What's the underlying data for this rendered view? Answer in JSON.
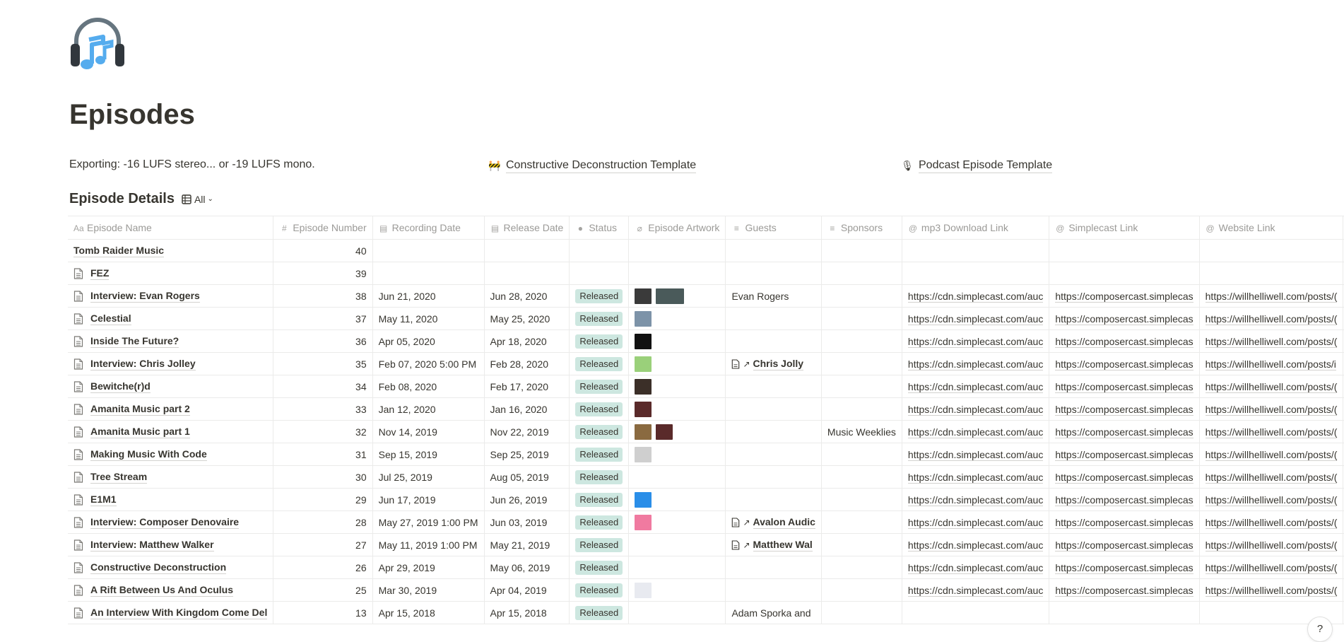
{
  "page": {
    "icon": "headphones-music-icon",
    "title": "Episodes"
  },
  "callouts": {
    "exporting_label": "Exporting:",
    "exporting_text": " -16 LUFS stereo... or -19 LUFS mono.",
    "links": [
      {
        "icon": "construction-barrier-icon",
        "label": "Constructive Deconstruction Template"
      },
      {
        "icon": "microphone-icon",
        "label": "Podcast Episode Template"
      }
    ]
  },
  "database": {
    "title": "Episode Details",
    "view_icon": "table-icon",
    "view_label": "All",
    "columns": [
      {
        "icon": "text-icon",
        "label": "Episode Name"
      },
      {
        "icon": "number-icon",
        "label": "Episode Number"
      },
      {
        "icon": "calendar-icon",
        "label": "Recording Date"
      },
      {
        "icon": "calendar-icon",
        "label": "Release Date"
      },
      {
        "icon": "select-icon",
        "label": "Status"
      },
      {
        "icon": "paperclip-icon",
        "label": "Episode Artwork"
      },
      {
        "icon": "text-lines-icon",
        "label": "Guests"
      },
      {
        "icon": "text-lines-icon",
        "label": "Sponsors"
      },
      {
        "icon": "url-icon",
        "label": "mp3 Download Link"
      },
      {
        "icon": "url-icon",
        "label": "Simplecast Link"
      },
      {
        "icon": "url-icon",
        "label": "Website Link"
      }
    ],
    "add_column_label": "+",
    "status_color": "#cde7e0",
    "rows": [
      {
        "name": "Tomb Raider Music",
        "has_doc_icon": false,
        "number": "40",
        "recording": "",
        "release": "",
        "status": "",
        "artwork": [],
        "guests": "",
        "guest_relation": false,
        "sponsors": "",
        "mp3": "",
        "simplecast": "",
        "website": ""
      },
      {
        "name": "FEZ",
        "has_doc_icon": true,
        "number": "39",
        "recording": "",
        "release": "",
        "status": "",
        "artwork": [],
        "guests": "",
        "guest_relation": false,
        "sponsors": "",
        "mp3": "",
        "simplecast": "",
        "website": ""
      },
      {
        "name": "Interview: Evan Rogers",
        "has_doc_icon": true,
        "number": "38",
        "recording": "Jun 21, 2020",
        "release": "Jun 28, 2020",
        "status": "Released",
        "artwork": [
          "#3a3a3a",
          "#4a5a5a"
        ],
        "guests": "Evan Rogers",
        "guest_relation": false,
        "sponsors": "",
        "mp3": "https://cdn.simplecast.com/auc",
        "simplecast": "https://composercast.simplecas",
        "website": "https://willhelliwell.com/posts/("
      },
      {
        "name": "Celestial",
        "has_doc_icon": true,
        "number": "37",
        "recording": "May 11, 2020",
        "release": "May 25, 2020",
        "status": "Released",
        "artwork": [
          "#7d93a8"
        ],
        "guests": "",
        "guest_relation": false,
        "sponsors": "",
        "mp3": "https://cdn.simplecast.com/auc",
        "simplecast": "https://composercast.simplecas",
        "website": "https://willhelliwell.com/posts/("
      },
      {
        "name": "Inside The Future?",
        "has_doc_icon": true,
        "number": "36",
        "recording": "Apr 05, 2020",
        "release": "Apr 18, 2020",
        "status": "Released",
        "artwork": [
          "#111111"
        ],
        "guests": "",
        "guest_relation": false,
        "sponsors": "",
        "mp3": "https://cdn.simplecast.com/auc",
        "simplecast": "https://composercast.simplecas",
        "website": "https://willhelliwell.com/posts/("
      },
      {
        "name": "Interview: Chris Jolley",
        "has_doc_icon": true,
        "number": "35",
        "recording": "Feb 07, 2020 5:00 PM",
        "release": "Feb 28, 2020",
        "status": "Released",
        "artwork": [
          "#9ad07a"
        ],
        "guests": "Chris Jolly",
        "guest_relation": true,
        "sponsors": "",
        "mp3": "https://cdn.simplecast.com/auc",
        "simplecast": "https://composercast.simplecas",
        "website": "https://willhelliwell.com/posts/i"
      },
      {
        "name": "Bewitche(r)d",
        "has_doc_icon": true,
        "number": "34",
        "recording": "Feb 08, 2020",
        "release": "Feb 17, 2020",
        "status": "Released",
        "artwork": [
          "#3b2f28"
        ],
        "guests": "",
        "guest_relation": false,
        "sponsors": "",
        "mp3": "https://cdn.simplecast.com/auc",
        "simplecast": "https://composercast.simplecas",
        "website": "https://willhelliwell.com/posts/("
      },
      {
        "name": "Amanita Music part 2",
        "has_doc_icon": true,
        "number": "33",
        "recording": "Jan 12, 2020",
        "release": "Jan 16, 2020",
        "status": "Released",
        "artwork": [
          "#5a2a2a"
        ],
        "guests": "",
        "guest_relation": false,
        "sponsors": "",
        "mp3": "https://cdn.simplecast.com/auc",
        "simplecast": "https://composercast.simplecas",
        "website": "https://willhelliwell.com/posts/("
      },
      {
        "name": "Amanita Music part 1",
        "has_doc_icon": true,
        "number": "32",
        "recording": "Nov 14, 2019",
        "release": "Nov 22, 2019",
        "status": "Released",
        "artwork": [
          "#8a6a40",
          "#5a2a2a"
        ],
        "guests": "",
        "guest_relation": false,
        "sponsors": "Music Weeklies",
        "mp3": "https://cdn.simplecast.com/auc",
        "simplecast": "https://composercast.simplecas",
        "website": "https://willhelliwell.com/posts/("
      },
      {
        "name": "Making Music With Code",
        "has_doc_icon": true,
        "number": "31",
        "recording": "Sep 15, 2019",
        "release": "Sep 25, 2019",
        "status": "Released",
        "artwork": [
          "#cfcfcf"
        ],
        "guests": "",
        "guest_relation": false,
        "sponsors": "",
        "mp3": "https://cdn.simplecast.com/auc",
        "simplecast": "https://composercast.simplecas",
        "website": "https://willhelliwell.com/posts/("
      },
      {
        "name": "Tree Stream",
        "has_doc_icon": true,
        "number": "30",
        "recording": "Jul 25, 2019",
        "release": "Aug 05, 2019",
        "status": "Released",
        "artwork": [],
        "guests": "",
        "guest_relation": false,
        "sponsors": "",
        "mp3": "https://cdn.simplecast.com/auc",
        "simplecast": "https://composercast.simplecas",
        "website": "https://willhelliwell.com/posts/("
      },
      {
        "name": "E1M1",
        "has_doc_icon": true,
        "number": "29",
        "recording": "Jun 17, 2019",
        "release": "Jun 26, 2019",
        "status": "Released",
        "artwork": [
          "#2a8ee8"
        ],
        "guests": "",
        "guest_relation": false,
        "sponsors": "",
        "mp3": "https://cdn.simplecast.com/auc",
        "simplecast": "https://composercast.simplecas",
        "website": "https://willhelliwell.com/posts/("
      },
      {
        "name": "Interview: Composer Denovaire",
        "has_doc_icon": true,
        "number": "28",
        "recording": "May 27, 2019 1:00 PM",
        "release": "Jun 03, 2019",
        "status": "Released",
        "artwork": [
          "#f07aa0"
        ],
        "guests": "Avalon Audic",
        "guest_relation": true,
        "sponsors": "",
        "mp3": "https://cdn.simplecast.com/auc",
        "simplecast": "https://composercast.simplecas",
        "website": "https://willhelliwell.com/posts/("
      },
      {
        "name": "Interview: Matthew Walker",
        "has_doc_icon": true,
        "number": "27",
        "recording": "May 11, 2019 1:00 PM",
        "release": "May 21, 2019",
        "status": "Released",
        "artwork": [],
        "guests": "Matthew Wal",
        "guest_relation": true,
        "sponsors": "",
        "mp3": "https://cdn.simplecast.com/auc",
        "simplecast": "https://composercast.simplecas",
        "website": "https://willhelliwell.com/posts/("
      },
      {
        "name": "Constructive Deconstruction",
        "has_doc_icon": true,
        "number": "26",
        "recording": "Apr 29, 2019",
        "release": "May 06, 2019",
        "status": "Released",
        "artwork": [],
        "guests": "",
        "guest_relation": false,
        "sponsors": "",
        "mp3": "https://cdn.simplecast.com/auc",
        "simplecast": "https://composercast.simplecas",
        "website": "https://willhelliwell.com/posts/("
      },
      {
        "name": "A Rift Between Us And Oculus",
        "has_doc_icon": true,
        "number": "25",
        "recording": "Mar 30, 2019",
        "release": "Apr 04, 2019",
        "status": "Released",
        "artwork": [
          "#e8eaf0"
        ],
        "guests": "",
        "guest_relation": false,
        "sponsors": "",
        "mp3": "https://cdn.simplecast.com/auc",
        "simplecast": "https://composercast.simplecas",
        "website": "https://willhelliwell.com/posts/("
      },
      {
        "name": "An Interview With Kingdom Come Del",
        "has_doc_icon": true,
        "number": "13",
        "recording": "Apr 15, 2018",
        "release": "Apr 15, 2018",
        "status": "Released",
        "artwork": [],
        "guests": "Adam Sporka and",
        "guest_relation": false,
        "sponsors": "",
        "mp3": "",
        "simplecast": "",
        "website": ""
      }
    ]
  },
  "help_button_label": "?"
}
